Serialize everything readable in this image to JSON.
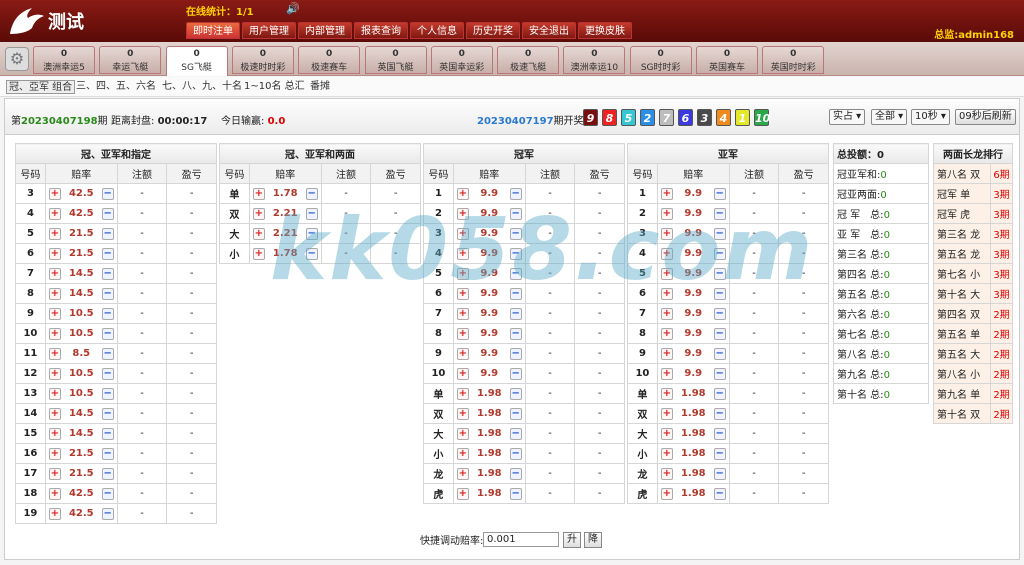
{
  "header": {
    "logo_text": "测试",
    "online_label": "在线统计：",
    "online_value": "1/1",
    "admin": "总监:admin168",
    "nav": [
      "即时注单",
      "用户管理",
      "内部管理",
      "报表查询",
      "个人信息",
      "历史开奖",
      "安全退出",
      "更换皮肤"
    ]
  },
  "games": [
    {
      "count": "0",
      "label": "澳洲幸运5"
    },
    {
      "count": "0",
      "label": "幸运飞艇"
    },
    {
      "count": "0",
      "label": "SG飞艇"
    },
    {
      "count": "0",
      "label": "极速时时彩"
    },
    {
      "count": "0",
      "label": "极速赛车"
    },
    {
      "count": "0",
      "label": "英国飞艇"
    },
    {
      "count": "0",
      "label": "英国幸运彩"
    },
    {
      "count": "0",
      "label": "极速飞艇"
    },
    {
      "count": "0",
      "label": "澳洲幸运10"
    },
    {
      "count": "0",
      "label": "SG时时彩"
    },
    {
      "count": "0",
      "label": "英国赛车"
    },
    {
      "count": "0",
      "label": "英国时时彩"
    }
  ],
  "subtabs": [
    "冠、亞军 组合",
    "三、四、五、六名",
    "七、八、九、十名",
    "1~10名 总汇",
    "番摊"
  ],
  "info": {
    "period_prefix": "第",
    "period": "20230407198",
    "period_suffix": "期",
    "close_label": "距离封盘:",
    "close_time": "00:00:17",
    "today_label": "今日输赢:",
    "today_value": "0.0",
    "last_period": "20230407197",
    "last_suffix": "期开奖:",
    "balls": [
      "9",
      "8",
      "5",
      "2",
      "7",
      "6",
      "3",
      "4",
      "1",
      "10"
    ],
    "select1": "实占",
    "select2": "全部",
    "select3": "10秒",
    "refresh": "09秒后刷新"
  },
  "cols": {
    "code": "号码",
    "odds": "赔率",
    "bet": "注额",
    "pl": "盈亏",
    "dash": "-"
  },
  "t1": {
    "title": "冠、亚军和指定",
    "rows": [
      {
        "k": "3",
        "v": "42.5"
      },
      {
        "k": "4",
        "v": "42.5"
      },
      {
        "k": "5",
        "v": "21.5"
      },
      {
        "k": "6",
        "v": "21.5"
      },
      {
        "k": "7",
        "v": "14.5"
      },
      {
        "k": "8",
        "v": "14.5"
      },
      {
        "k": "9",
        "v": "10.5"
      },
      {
        "k": "10",
        "v": "10.5"
      },
      {
        "k": "11",
        "v": "8.5"
      },
      {
        "k": "12",
        "v": "10.5"
      },
      {
        "k": "13",
        "v": "10.5"
      },
      {
        "k": "14",
        "v": "14.5"
      },
      {
        "k": "15",
        "v": "14.5"
      },
      {
        "k": "16",
        "v": "21.5"
      },
      {
        "k": "17",
        "v": "21.5"
      },
      {
        "k": "18",
        "v": "42.5"
      },
      {
        "k": "19",
        "v": "42.5"
      }
    ]
  },
  "t2": {
    "title": "冠、亚军和两面",
    "rows": [
      {
        "k": "单",
        "v": "1.78"
      },
      {
        "k": "双",
        "v": "2.21"
      },
      {
        "k": "大",
        "v": "2.21"
      },
      {
        "k": "小",
        "v": "1.78"
      }
    ]
  },
  "t3": {
    "title": "冠军",
    "rows": [
      {
        "k": "1",
        "v": "9.9"
      },
      {
        "k": "2",
        "v": "9.9"
      },
      {
        "k": "3",
        "v": "9.9"
      },
      {
        "k": "4",
        "v": "9.9"
      },
      {
        "k": "5",
        "v": "9.9"
      },
      {
        "k": "6",
        "v": "9.9"
      },
      {
        "k": "7",
        "v": "9.9"
      },
      {
        "k": "8",
        "v": "9.9"
      },
      {
        "k": "9",
        "v": "9.9"
      },
      {
        "k": "10",
        "v": "9.9"
      },
      {
        "k": "单",
        "v": "1.98"
      },
      {
        "k": "双",
        "v": "1.98"
      },
      {
        "k": "大",
        "v": "1.98"
      },
      {
        "k": "小",
        "v": "1.98"
      },
      {
        "k": "龙",
        "v": "1.98"
      },
      {
        "k": "虎",
        "v": "1.98"
      }
    ]
  },
  "t4": {
    "title": "亚军",
    "rows": [
      {
        "k": "1",
        "v": "9.9"
      },
      {
        "k": "2",
        "v": "9.9"
      },
      {
        "k": "3",
        "v": "9.9"
      },
      {
        "k": "4",
        "v": "9.9"
      },
      {
        "k": "5",
        "v": "9.9"
      },
      {
        "k": "6",
        "v": "9.9"
      },
      {
        "k": "7",
        "v": "9.9"
      },
      {
        "k": "8",
        "v": "9.9"
      },
      {
        "k": "9",
        "v": "9.9"
      },
      {
        "k": "10",
        "v": "9.9"
      },
      {
        "k": "单",
        "v": "1.98"
      },
      {
        "k": "双",
        "v": "1.98"
      },
      {
        "k": "大",
        "v": "1.98"
      },
      {
        "k": "小",
        "v": "1.98"
      },
      {
        "k": "龙",
        "v": "1.98"
      },
      {
        "k": "虎",
        "v": "1.98"
      }
    ]
  },
  "side": {
    "title": "总投额：",
    "title_value": "0",
    "rows": [
      {
        "l": "冠亚军和:",
        "v": "0"
      },
      {
        "l": "冠亚两面:",
        "v": "0"
      },
      {
        "l": "冠 军　总:",
        "v": "0"
      },
      {
        "l": "亚 军　总:",
        "v": "0"
      },
      {
        "l": "第三名 总:",
        "v": "0"
      },
      {
        "l": "第四名 总:",
        "v": "0"
      },
      {
        "l": "第五名 总:",
        "v": "0"
      },
      {
        "l": "第六名 总:",
        "v": "0"
      },
      {
        "l": "第七名 总:",
        "v": "0"
      },
      {
        "l": "第八名 总:",
        "v": "0"
      },
      {
        "l": "第九名 总:",
        "v": "0"
      },
      {
        "l": "第十名 总:",
        "v": "0"
      }
    ]
  },
  "dragon": {
    "title": "两面长龙排行",
    "rows": [
      {
        "n": "第八名 双",
        "p": "6期"
      },
      {
        "n": "冠军 单",
        "p": "3期"
      },
      {
        "n": "冠军 虎",
        "p": "3期"
      },
      {
        "n": "第三名 龙",
        "p": "3期"
      },
      {
        "n": "第五名 龙",
        "p": "3期"
      },
      {
        "n": "第七名 小",
        "p": "3期"
      },
      {
        "n": "第十名 大",
        "p": "3期"
      },
      {
        "n": "第四名 双",
        "p": "2期"
      },
      {
        "n": "第五名 单",
        "p": "2期"
      },
      {
        "n": "第五名 大",
        "p": "2期"
      },
      {
        "n": "第八名 小",
        "p": "2期"
      },
      {
        "n": "第九名 单",
        "p": "2期"
      },
      {
        "n": "第十名 双",
        "p": "2期"
      }
    ]
  },
  "quick": {
    "label": "快捷调动赔率:",
    "value": "0.001",
    "up": "升",
    "down": "降"
  },
  "watermark": "kk058.com",
  "colors": {
    "ball_colors": {
      "1": "#e6e62a",
      "2": "#2b8fe8",
      "3": "#4a4a4a",
      "4": "#f08a1d",
      "5": "#35c7d6",
      "6": "#3a3ae0",
      "7": "#bdbdbd",
      "8": "#e22",
      "9": "#7a0f0f",
      "10": "#2aa84a"
    }
  }
}
